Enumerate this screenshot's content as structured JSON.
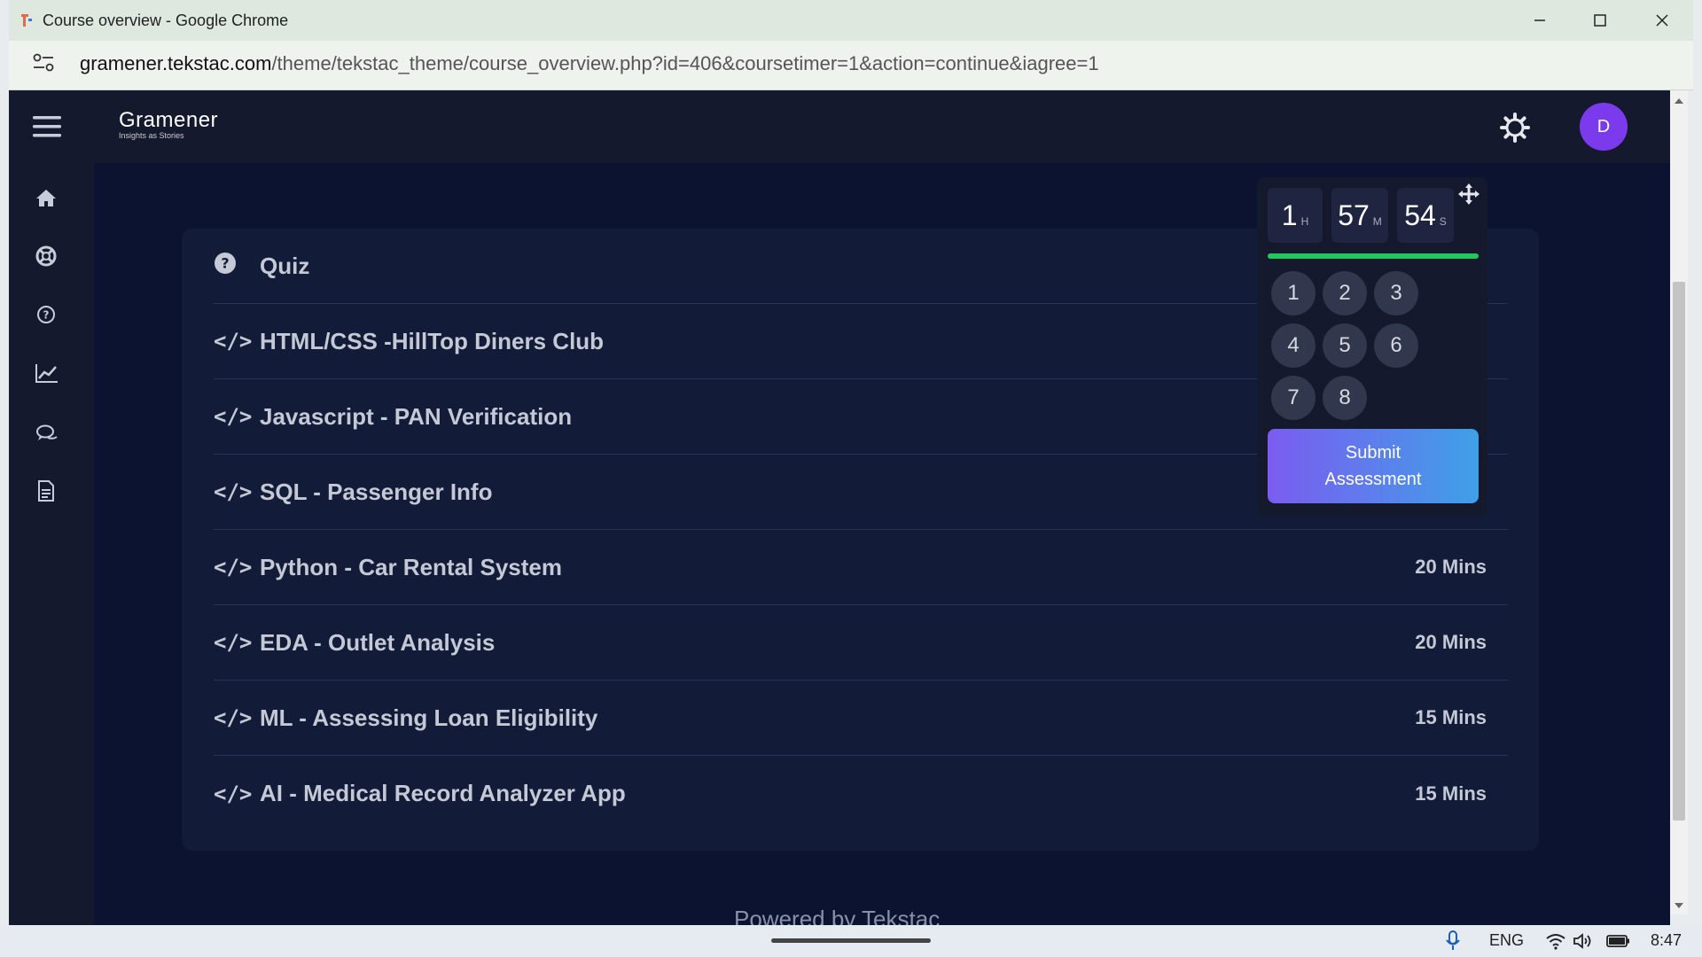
{
  "browser": {
    "title": "Course overview - Google Chrome",
    "url_host": "gramener.tekstac.com",
    "url_path": "/theme/tekstac_theme/course_overview.php?id=406&coursetimer=1&action=continue&iagree=1"
  },
  "app": {
    "logo_title": "Gramener",
    "logo_sub": "Insights as Stories",
    "avatar_letter": "D",
    "footer": "Powered by Tekstac"
  },
  "course": {
    "items": [
      {
        "icon": "question-icon",
        "label": "Quiz",
        "duration": ""
      },
      {
        "icon": "code-icon",
        "label": "HTML/CSS -HillTop Diners Club",
        "duration": ""
      },
      {
        "icon": "code-icon",
        "label": "Javascript - PAN Verification",
        "duration": ""
      },
      {
        "icon": "code-icon",
        "label": "SQL - Passenger Info",
        "duration": ""
      },
      {
        "icon": "code-icon",
        "label": "Python - Car Rental System",
        "duration": "20 Mins"
      },
      {
        "icon": "code-icon",
        "label": "EDA - Outlet Analysis",
        "duration": "20 Mins"
      },
      {
        "icon": "code-icon",
        "label": "ML - Assessing Loan Eligibility",
        "duration": "15 Mins"
      },
      {
        "icon": "code-icon",
        "label": "AI - Medical Record Analyzer App",
        "duration": "15 Mins"
      }
    ]
  },
  "timer": {
    "hours": "1",
    "hours_unit": "H",
    "minutes": "57",
    "minutes_unit": "M",
    "seconds": "54",
    "seconds_unit": "S",
    "progress_fraction": 1.0,
    "questions": [
      "1",
      "2",
      "3",
      "4",
      "5",
      "6",
      "7",
      "8"
    ],
    "submit_line1": "Submit",
    "submit_line2": "Assessment"
  },
  "taskbar": {
    "language": "ENG",
    "time": "8:47"
  },
  "colors": {
    "accent_purple": "#7c3aed",
    "progress_green": "#22c55e"
  }
}
